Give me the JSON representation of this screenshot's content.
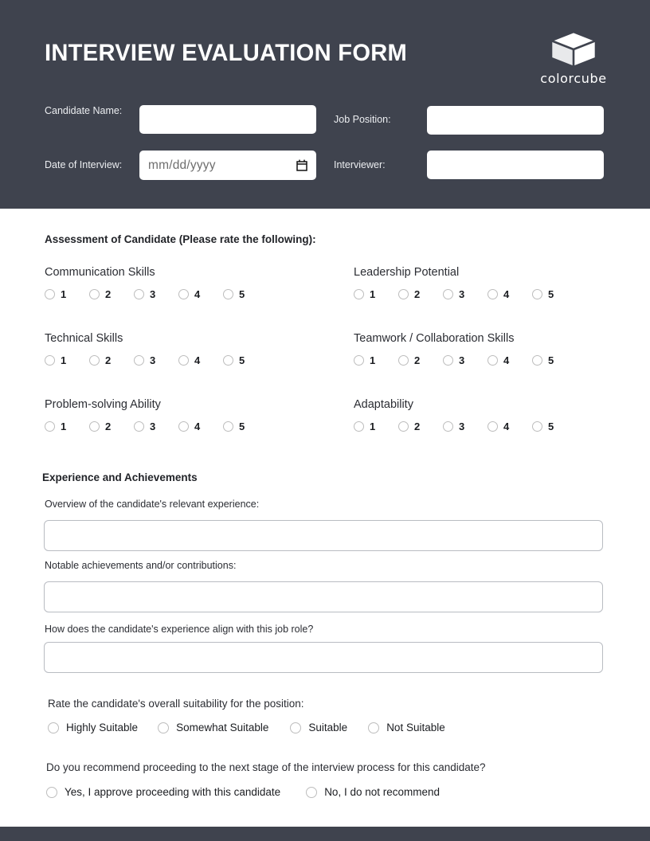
{
  "header": {
    "title": "INTERVIEW EVALUATION FORM",
    "brand": {
      "name": "colorcube",
      "icon": "cube-icon"
    },
    "bg_color": "#3f434e",
    "fields": [
      {
        "label": "Candidate Name:",
        "value": "",
        "placeholder": ""
      },
      {
        "label": "Job Position:",
        "value": "",
        "placeholder": ""
      },
      {
        "label": "Date of Interview:",
        "value": "",
        "placeholder": "mm/dd/yyyy",
        "icon": "calendar-icon"
      },
      {
        "label": "Interviewer:",
        "value": "",
        "placeholder": ""
      }
    ]
  },
  "assessment": {
    "heading": "Assessment of Candidate (Please rate the following):",
    "scale": [
      "1",
      "2",
      "3",
      "4",
      "5"
    ],
    "criteria_left": [
      {
        "title": "Communication Skills"
      },
      {
        "title": "Technical Skills"
      },
      {
        "title": "Problem-solving Ability"
      }
    ],
    "criteria_right": [
      {
        "title": "Leadership Potential"
      },
      {
        "title": "Teamwork / Collaboration Skills"
      },
      {
        "title": "Adaptability"
      }
    ]
  },
  "experience": {
    "heading": "Experience and Achievements",
    "questions": [
      {
        "label": "Overview of the candidate's relevant experience:",
        "value": ""
      },
      {
        "label": "Notable achievements and/or contributions:",
        "value": ""
      },
      {
        "label": "How does the candidate's experience align with this job role?",
        "value": ""
      }
    ]
  },
  "suitability": {
    "question": "Rate the candidate's overall suitability for the position:",
    "options": [
      "Highly Suitable",
      "Somewhat Suitable",
      "Suitable",
      "Not Suitable"
    ]
  },
  "recommendation": {
    "question": "Do you recommend proceeding to the next stage of the interview process for this candidate?",
    "options": [
      "Yes, I approve proceeding with this candidate",
      "No, I do not recommend"
    ]
  },
  "footer": {
    "bg_color": "#3f434e"
  }
}
